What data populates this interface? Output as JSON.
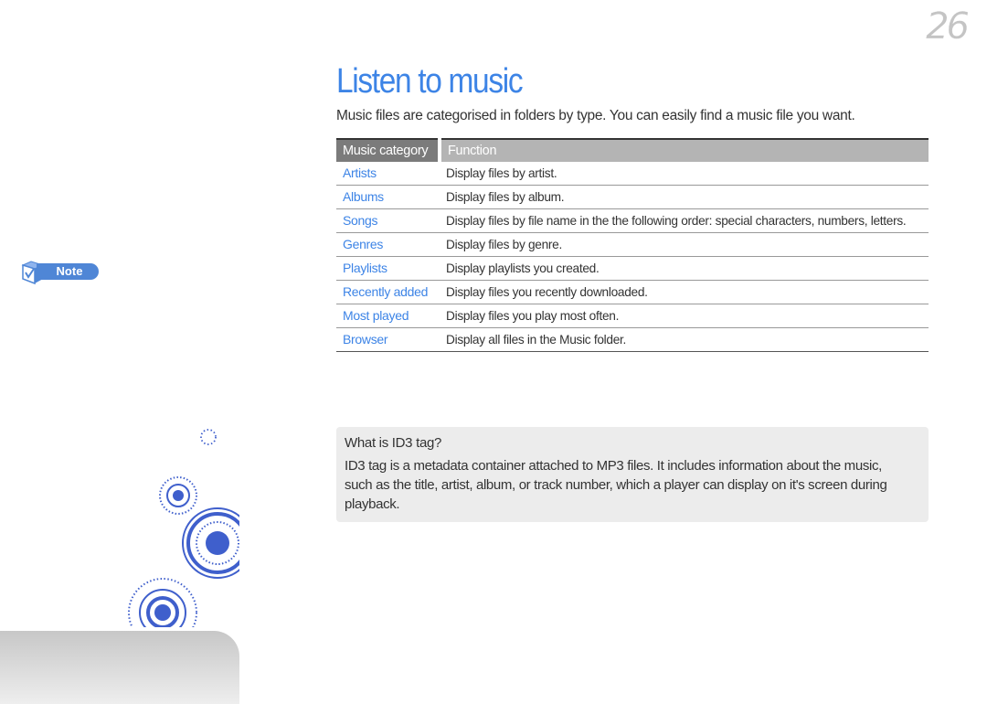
{
  "page": {
    "number": "26",
    "title": "Listen to music",
    "intro": "Music files are categorised in folders by type. You can easily find a music file you want."
  },
  "table": {
    "headers": [
      "Music category",
      "Function"
    ],
    "rows": [
      {
        "category": "Artists",
        "function": "Display files by artist."
      },
      {
        "category": "Albums",
        "function": "Display files by album."
      },
      {
        "category": "Songs",
        "function": "Display files by file name in the the following order: special characters, numbers, letters."
      },
      {
        "category": "Genres",
        "function": "Display files by genre."
      },
      {
        "category": "Playlists",
        "function": "Display playlists you created."
      },
      {
        "category": "Recently added",
        "function": "Display files you recently downloaded."
      },
      {
        "category": "Most played",
        "function": "Display files you play most often."
      },
      {
        "category": "Browser",
        "function": "Display all files in the Music folder."
      }
    ]
  },
  "note": {
    "label": "Note",
    "icon": "checkbox-cube-icon"
  },
  "id3": {
    "title": "What is ID3 tag?",
    "body": "ID3 tag is a metadata container attached to MP3 files. It includes information about the music, such as the title, artist, album, or track number, which a player can display on it's screen during playback."
  },
  "colors": {
    "accent": "#3d84e6",
    "header_dark": "#7b7b7b",
    "header_light": "#b4b4b4",
    "note_blue": "#4f86d6",
    "circle_blue": "#3f5fcc"
  }
}
